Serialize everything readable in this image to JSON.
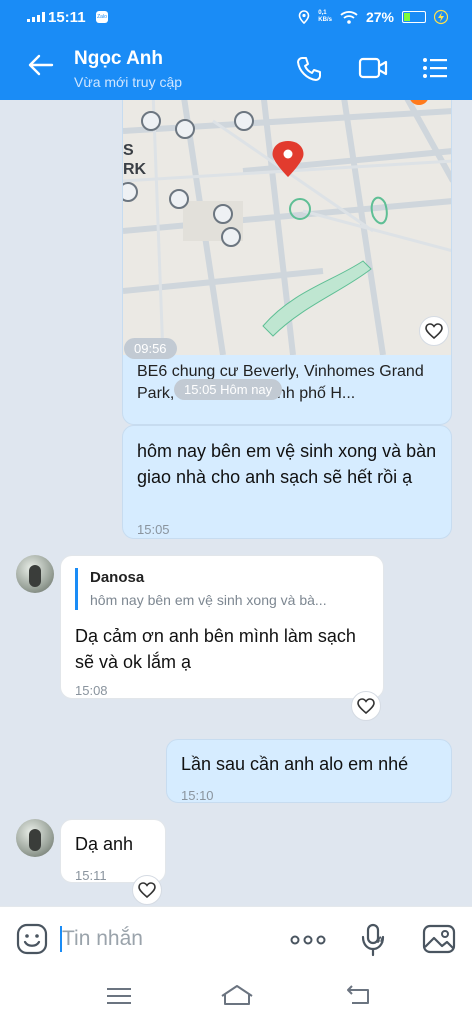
{
  "status_bar": {
    "time": "15:11",
    "network_speed": "0,1\nKB/s",
    "battery": "27%",
    "battery_level": 0.27,
    "zalo_icon": "Zalo"
  },
  "header": {
    "name": "Ngọc Anh",
    "status": "Vừa mới truy cập"
  },
  "location_card": {
    "address": "BE6 chung cư Beverly, Vinhomes Grand Park, Thủ Đức, Thành phố H...",
    "map_label": "S\nRK",
    "time": "09:56"
  },
  "date_divider": "15:05 Hôm nay",
  "messages": [
    {
      "side": "me",
      "text": "hôm nay bên em vệ sinh xong và bàn giao nhà cho anh sạch sẽ hết rồi ạ",
      "time": "15:05"
    },
    {
      "side": "them",
      "quote_name": "Danosa",
      "quote_text": "hôm nay bên em vệ sinh xong và bà...",
      "text": "Dạ cảm ơn anh bên mình làm sạch sẽ và ok lắm ạ",
      "time": "15:08"
    },
    {
      "side": "me",
      "text": "Lần sau cần anh alo em nhé",
      "time": "15:10"
    },
    {
      "side": "them",
      "text": "Dạ anh",
      "time": "15:11"
    }
  ],
  "composer": {
    "placeholder": "Tin nhắn"
  },
  "colors": {
    "accent": "#1a8cf6",
    "my_bubble": "#d6ecff",
    "background": "#dfe6ef"
  }
}
